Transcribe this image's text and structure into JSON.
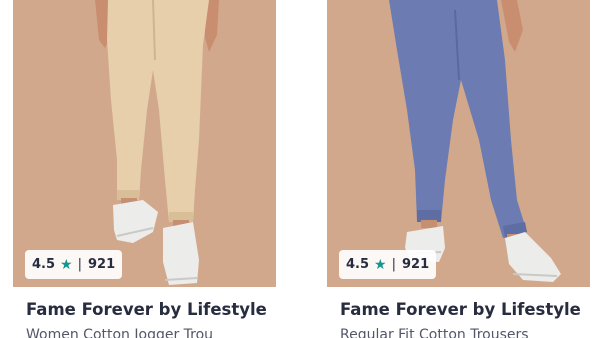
{
  "products": [
    {
      "rating": "4.5",
      "rating_count": "921",
      "brand": "Fame Forever by Lifestyle",
      "title": "Women Cotton Jogger Trou",
      "image_alt": "beige cotton joggers",
      "colors": {
        "background": "#d2a88c",
        "garment": "#e8d2ad",
        "shoe": "#ececea"
      }
    },
    {
      "rating": "4.5",
      "rating_count": "921",
      "brand": "Fame Forever by Lifestyle",
      "title": "Regular Fit Cotton Trousers",
      "image_alt": "blue cotton trousers",
      "colors": {
        "background": "#d2a88c",
        "garment": "#6d7db3",
        "shoe": "#ececea"
      }
    }
  ],
  "icons": {
    "rating_star": "star-icon"
  },
  "colors": {
    "star": "#14958f",
    "text_primary": "#282c3f",
    "text_secondary": "#535766"
  }
}
